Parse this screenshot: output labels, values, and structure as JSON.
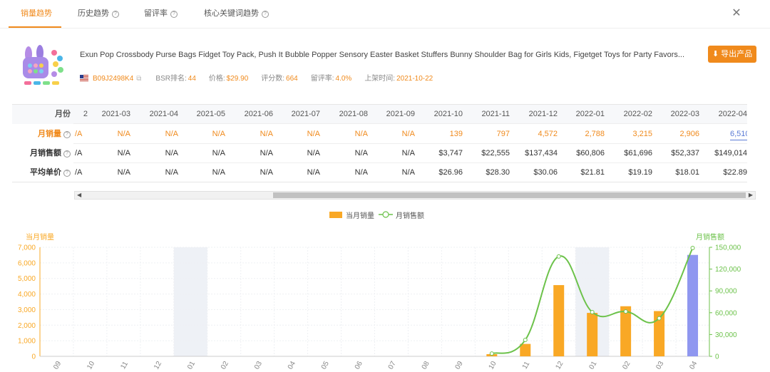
{
  "tabs": [
    {
      "label": "销量趋势",
      "active": true,
      "help": false
    },
    {
      "label": "历史趋势",
      "active": false,
      "help": true
    },
    {
      "label": "留评率",
      "active": false,
      "help": true
    },
    {
      "label": "核心关键词趋势",
      "active": false,
      "help": true
    }
  ],
  "close_icon": "close-icon",
  "product": {
    "title": "Exun Pop Crossbody Purse Bags Fidget Toy Pack, Push It Bubble Popper Sensory Easter Basket Stuffers Bunny Shoulder Bag for Girls Kids, Figetget Toys for Party Favors...",
    "asin": "B09J2498K4",
    "bsr_label": "BSR排名:",
    "bsr": "44",
    "price_label": "价格:",
    "price": "$29.90",
    "rating_count_label": "评分数:",
    "rating_count": "664",
    "review_rate_label": "留评率:",
    "review_rate": "4.0%",
    "launch_label": "上架时间:",
    "launch": "2021-10-22",
    "export_label": "导出产品"
  },
  "table": {
    "header_label": "月份",
    "first_partial": "2",
    "months": [
      "2021-03",
      "2021-04",
      "2021-05",
      "2021-06",
      "2021-07",
      "2021-08",
      "2021-09",
      "2021-10",
      "2021-11",
      "2021-12",
      "2022-01",
      "2022-02",
      "2022-03",
      "2022-04"
    ],
    "rows": [
      {
        "label": "月销量",
        "first": "/A",
        "values": [
          "N/A",
          "N/A",
          "N/A",
          "N/A",
          "N/A",
          "N/A",
          "N/A",
          "139",
          "797",
          "4,572",
          "2,788",
          "3,215",
          "2,906",
          "6,510"
        ]
      },
      {
        "label": "月销售额",
        "first": "/A",
        "values": [
          "N/A",
          "N/A",
          "N/A",
          "N/A",
          "N/A",
          "N/A",
          "N/A",
          "$3,747",
          "$22,555",
          "$137,434",
          "$60,806",
          "$61,696",
          "$52,337",
          "$149,014"
        ]
      },
      {
        "label": "平均单价",
        "first": "/A",
        "values": [
          "N/A",
          "N/A",
          "N/A",
          "N/A",
          "N/A",
          "N/A",
          "N/A",
          "$26.96",
          "$28.30",
          "$30.06",
          "$21.81",
          "$19.19",
          "$18.01",
          "$22.89"
        ]
      }
    ]
  },
  "legend": {
    "bar": "当月销量",
    "line": "月销售额"
  },
  "chart_data": {
    "type": "bar",
    "categories": [
      "09",
      "10",
      "11",
      "12",
      "01",
      "02",
      "03",
      "04",
      "05",
      "06",
      "07",
      "08",
      "09",
      "10",
      "11",
      "12",
      "01",
      "02",
      "03",
      "04"
    ],
    "series": [
      {
        "name": "当月销量",
        "type": "bar",
        "axis": "left",
        "values": [
          0,
          0,
          0,
          0,
          0,
          0,
          0,
          0,
          0,
          0,
          0,
          0,
          0,
          139,
          797,
          4572,
          2788,
          3215,
          2906,
          6510
        ]
      },
      {
        "name": "月销售额",
        "type": "line",
        "axis": "right",
        "values": [
          0,
          0,
          0,
          0,
          0,
          0,
          0,
          0,
          0,
          0,
          0,
          0,
          0,
          3747,
          22555,
          137434,
          60806,
          61696,
          52337,
          149014
        ]
      }
    ],
    "ylabel_left": "当月销量",
    "ylabel_right": "月销售额",
    "ylim_left": [
      0,
      7000
    ],
    "yticks_left": [
      "0",
      "1,000",
      "2,000",
      "3,000",
      "4,000",
      "5,000",
      "6,000",
      "7,000"
    ],
    "ylim_right": [
      0,
      150000
    ],
    "yticks_right": [
      "0",
      "30,000",
      "60,000",
      "90,000",
      "120,000",
      "150,000"
    ],
    "highlighted_columns": [
      4,
      16
    ],
    "highlighted_bar_index": 19,
    "colors": {
      "bar": "#f9a825",
      "bar_highlight": "#8f97f0",
      "line": "#6cc24a",
      "left_axis": "#f9a825",
      "right_axis": "#6cc24a",
      "band": "#eef1f6"
    },
    "grid": true
  }
}
